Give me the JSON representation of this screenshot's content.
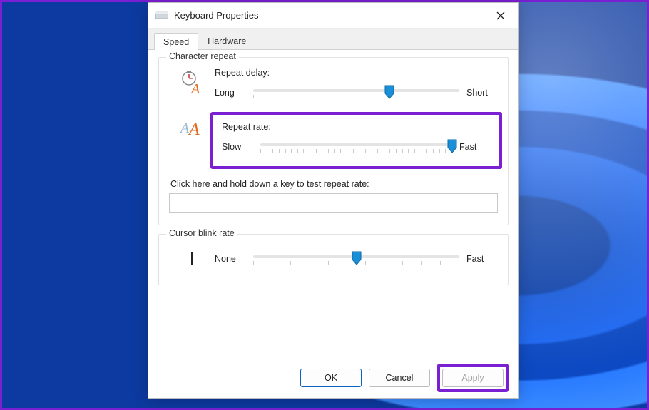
{
  "window": {
    "title": "Keyboard Properties"
  },
  "tabs": [
    {
      "label": "Speed",
      "active": true
    },
    {
      "label": "Hardware",
      "active": false
    }
  ],
  "groups": {
    "char_repeat": {
      "title": "Character repeat",
      "delay": {
        "label": "Repeat delay:",
        "left": "Long",
        "right": "Short",
        "value_percent": 66
      },
      "rate": {
        "label": "Repeat rate:",
        "left": "Slow",
        "right": "Fast",
        "value_percent": 100
      },
      "test_label": "Click here and hold down a key to test repeat rate:"
    },
    "cursor_blink": {
      "title": "Cursor blink rate",
      "left": "None",
      "right": "Fast",
      "value_percent": 50
    }
  },
  "buttons": {
    "ok": "OK",
    "cancel": "Cancel",
    "apply": "Apply"
  }
}
